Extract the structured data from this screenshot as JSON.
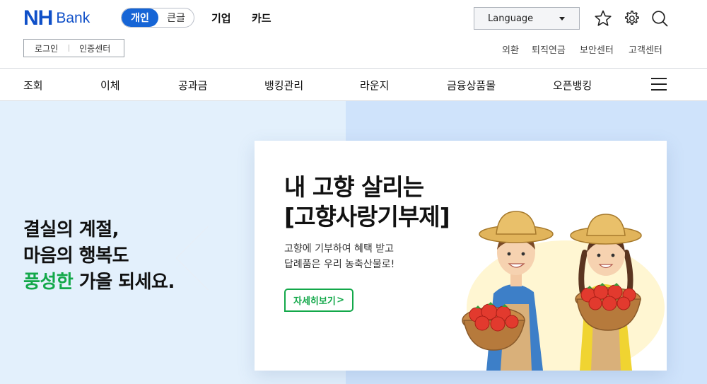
{
  "header": {
    "logo_nh": "NH",
    "logo_bank": "Bank",
    "segment": {
      "active": "개인",
      "inactive": "큰글"
    },
    "categories": [
      "기업",
      "카드"
    ],
    "language": {
      "label": "Language"
    },
    "login": {
      "login_label": "로그인",
      "cert_label": "인증센터"
    },
    "util_links": [
      "외환",
      "퇴직연금",
      "보안센터",
      "고객센터"
    ],
    "icons": [
      "star-icon",
      "gear-icon",
      "search-icon"
    ]
  },
  "gnb": {
    "items": [
      "조회",
      "이체",
      "공과금",
      "뱅킹관리",
      "라운지",
      "금융상품몰",
      "오픈뱅킹"
    ],
    "menu_icon": "hamburger-icon"
  },
  "hero": {
    "copy_line1": "결실의 계절,",
    "copy_line2": "마음의 행복도",
    "copy_line3_green": "풍성한",
    "copy_line3_rest": " 가을 되세요.",
    "card": {
      "title_line1": "내 고향 살리는",
      "title_line2": "[고향사랑기부제]",
      "desc_line1": "고향에 기부하여 혜택 받고",
      "desc_line2": "답례품은 우리 농축산물로!",
      "button_label": "자세히보기",
      "button_arrow": ">"
    }
  },
  "colors": {
    "brand_blue": "#1050c8",
    "segment_blue": "#1665d6",
    "accent_green": "#13a84a",
    "hero_left_bg": "#e3f0fc",
    "hero_right_bg": "#cfe3fb"
  }
}
